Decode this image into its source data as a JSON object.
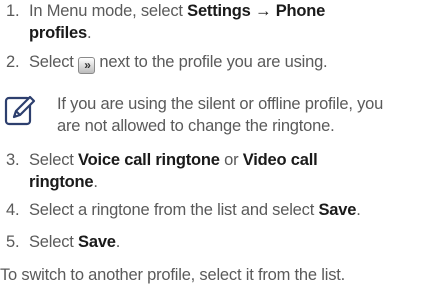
{
  "steps": [
    {
      "num": "1.",
      "line1": [
        "In Menu mode, select ",
        "Settings → Phone"
      ],
      "line2": "profiles",
      "line2_tail": "."
    },
    {
      "num": "2.",
      "before": "Select ",
      "icon_glyph": "»",
      "after": " next to the profile you are using."
    },
    {
      "num": "3.",
      "line1": [
        "Select ",
        "Voice call ringtone",
        " or ",
        "Video call"
      ],
      "line2": "ringtone",
      "line2_tail": "."
    },
    {
      "num": "4.",
      "before": "Select a ringtone from the list and select ",
      "bold": "Save",
      "after": "."
    },
    {
      "num": "5.",
      "before": "Select ",
      "bold": "Save",
      "after": "."
    }
  ],
  "note": {
    "icon": "note-pencil-icon",
    "line1": "If you are using the silent or offline profile, you",
    "line2": "are not allowed to change the ringtone."
  },
  "footer": "To switch to another profile, select it from the list."
}
